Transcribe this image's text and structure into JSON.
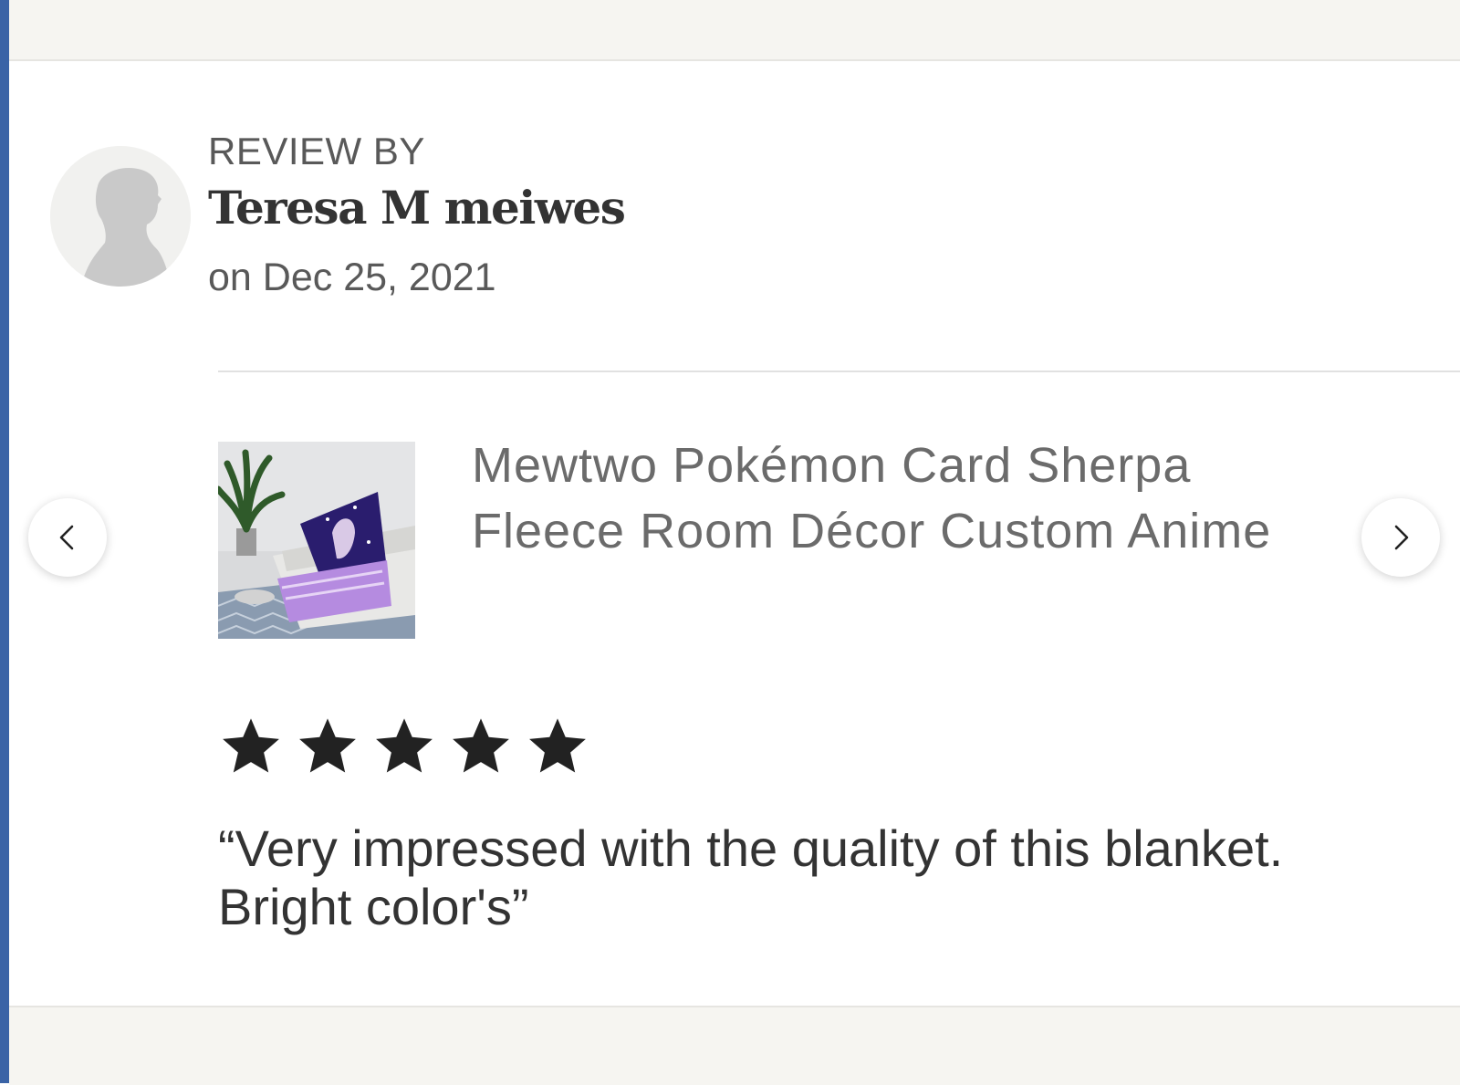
{
  "review": {
    "heading": "REVIEW BY",
    "reviewer_name": "Teresa M meiwes",
    "date": "on Dec 25, 2021",
    "rating": 5,
    "rating_max": 5,
    "text": "“Very impressed with the quality of this blanket. Bright color's”"
  },
  "product": {
    "title": "Mewtwo Pokémon Card Sherpa Fleece Room Décor Custom Anime"
  },
  "icons": {
    "avatar": "default-user-avatar-icon",
    "prev": "chevron-left-icon",
    "next": "chevron-right-icon",
    "star": "star-icon"
  },
  "colors": {
    "frame_edge": "#3a63a6",
    "bar_background": "#f6f5f1",
    "star": "#222222",
    "muted_text": "#595959",
    "title_text": "#6b6b6b"
  }
}
